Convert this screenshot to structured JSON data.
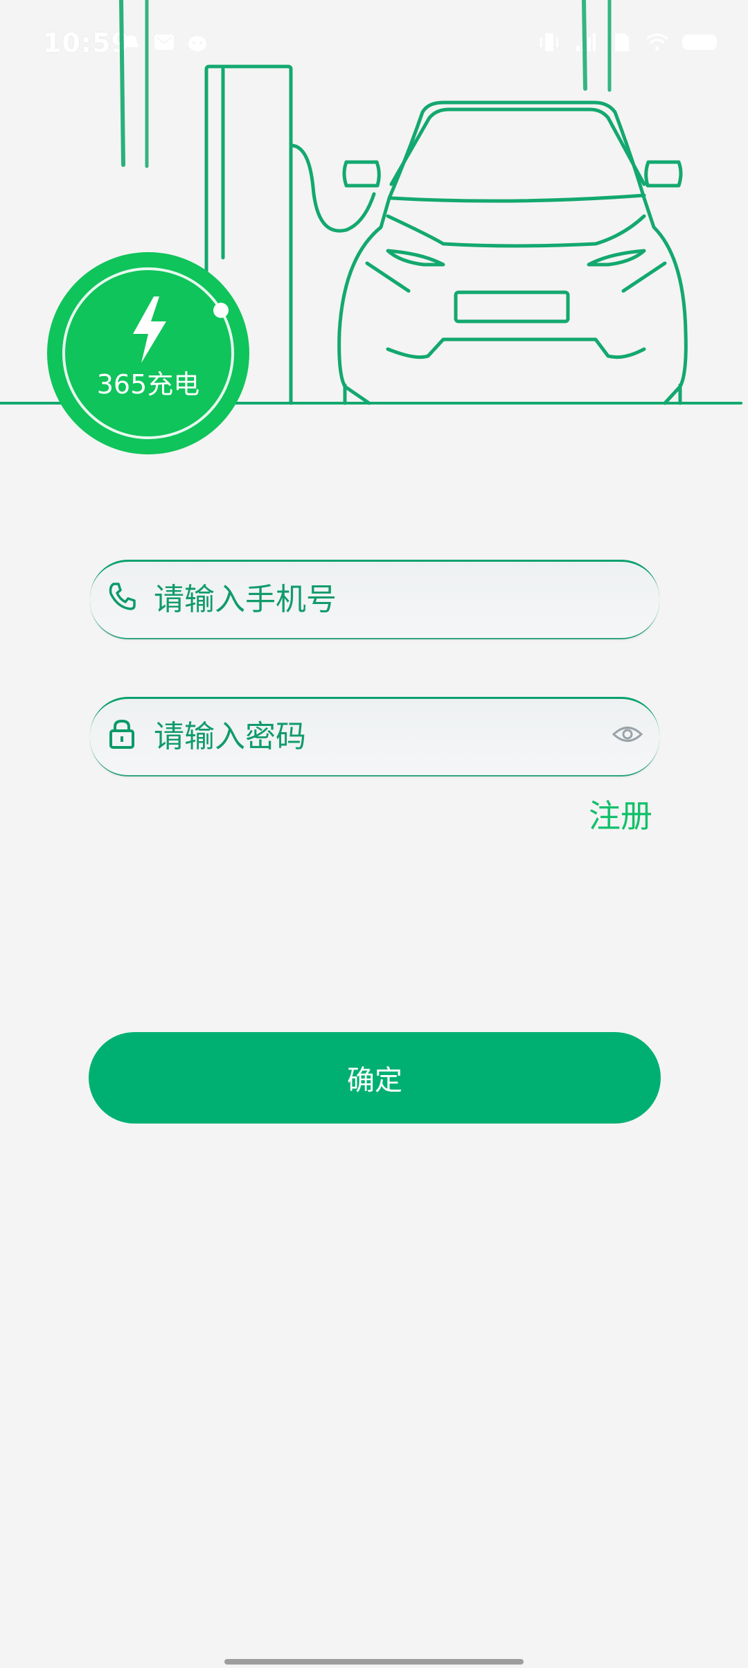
{
  "status_bar": {
    "time": "10:59",
    "left_icons": [
      "notification-icon",
      "mail-icon",
      "app-icon"
    ],
    "right_icons": [
      "vibrate-icon",
      "signal-icon",
      "sim-icon",
      "wifi-icon",
      "battery-icon"
    ]
  },
  "hero": {
    "logo_text": "365充电",
    "brand_color": "#0fc45a",
    "line_color": "#13a86f"
  },
  "login_form": {
    "phone_placeholder": "请输入手机号",
    "phone_value": "",
    "password_placeholder": "请输入密码",
    "password_value": "",
    "register_label": "注册",
    "confirm_label": "确定",
    "accent_color": "#00b072"
  }
}
